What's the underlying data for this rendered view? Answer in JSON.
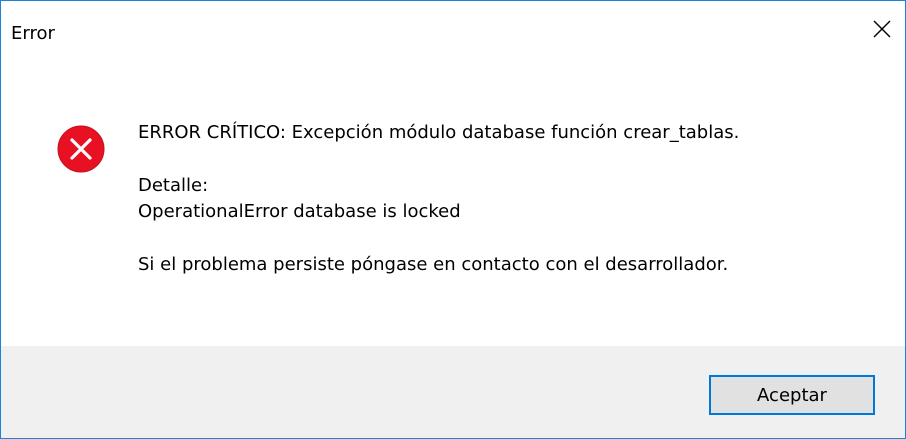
{
  "window": {
    "title": "Error",
    "close_icon": "close-icon"
  },
  "message": {
    "icon": "error-icon",
    "line1": "ERROR CRÍTICO: Excepción módulo database función crear_tablas.",
    "detail_label": "Detalle:",
    "detail_text": "OperationalError database is locked",
    "contact_text": "Si el problema persiste póngase en contacto con el desarrollador."
  },
  "buttons": {
    "ok_label": "Aceptar"
  },
  "colors": {
    "window_border": "#1883d7",
    "error_red": "#e81123",
    "footer_bg": "#f0f0f0",
    "button_border": "#0078d7",
    "button_bg": "#e1e1e1"
  }
}
